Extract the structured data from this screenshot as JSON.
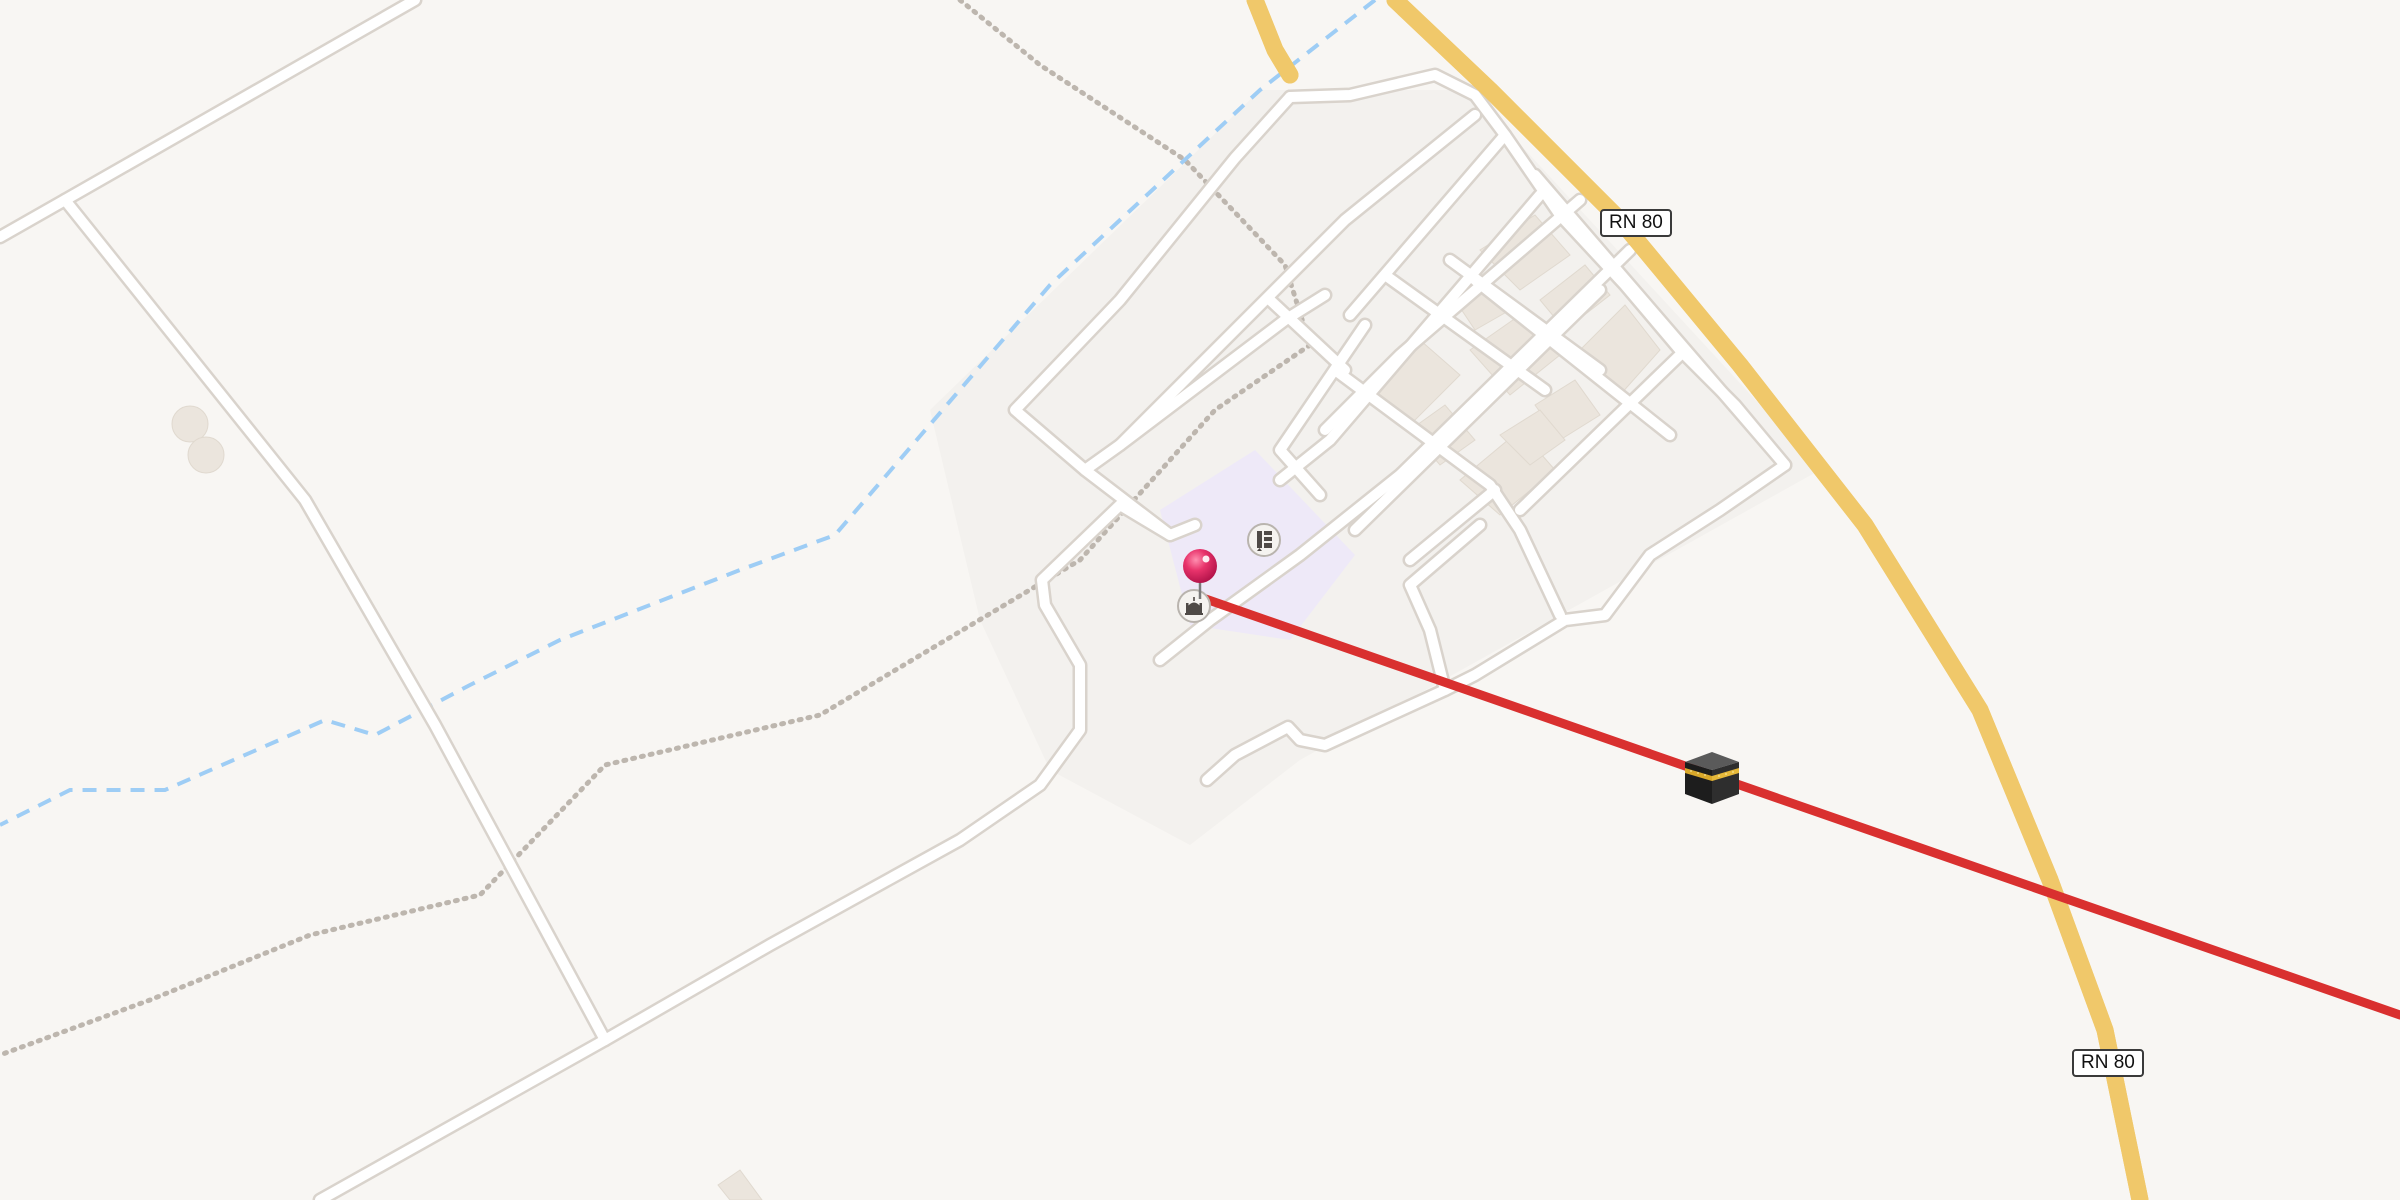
{
  "map": {
    "road_labels": [
      {
        "id": "rn80-north",
        "text": "RN 80"
      },
      {
        "id": "rn80-south",
        "text": "RN 80"
      }
    ],
    "markers": {
      "location_pin": {
        "icon": "location-pin-icon",
        "color": "#e8336b"
      },
      "qibla_target": {
        "icon": "kaaba-icon"
      },
      "mosque": {
        "icon": "mosque-icon"
      },
      "school": {
        "icon": "school-icon"
      }
    },
    "qibla_line": {
      "color": "#d9302f"
    },
    "colors": {
      "background": "#f8f6f3",
      "primary_road_fill": "#fde8a5",
      "primary_road_casing": "#f0c86a",
      "minor_road": "#ffffff",
      "waterway": "#9ecdf5",
      "track": "#bdb6ae",
      "school_area": "#eee9f8",
      "building": "#ebe5dd"
    }
  }
}
